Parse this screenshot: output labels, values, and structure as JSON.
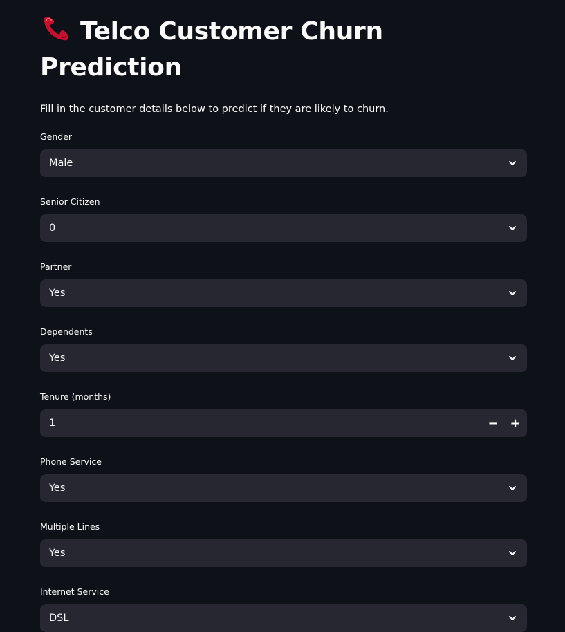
{
  "header": {
    "title": "Telco Customer Churn Prediction",
    "icon": "telephone-receiver-icon",
    "description": "Fill in the customer details below to predict if they are likely to churn."
  },
  "form": {
    "gender": {
      "label": "Gender",
      "value": "Male"
    },
    "senior_citizen": {
      "label": "Senior Citizen",
      "value": "0"
    },
    "partner": {
      "label": "Partner",
      "value": "Yes"
    },
    "dependents": {
      "label": "Dependents",
      "value": "Yes"
    },
    "tenure": {
      "label": "Tenure (months)",
      "value": "1",
      "decrement": "−",
      "increment": "+"
    },
    "phone_service": {
      "label": "Phone Service",
      "value": "Yes"
    },
    "multiple_lines": {
      "label": "Multiple Lines",
      "value": "Yes"
    },
    "internet_service": {
      "label": "Internet Service",
      "value": "DSL"
    }
  },
  "colors": {
    "background": "#0e1117",
    "input_background": "#262730",
    "text": "#fafafa",
    "icon_red": "#c8102e"
  }
}
